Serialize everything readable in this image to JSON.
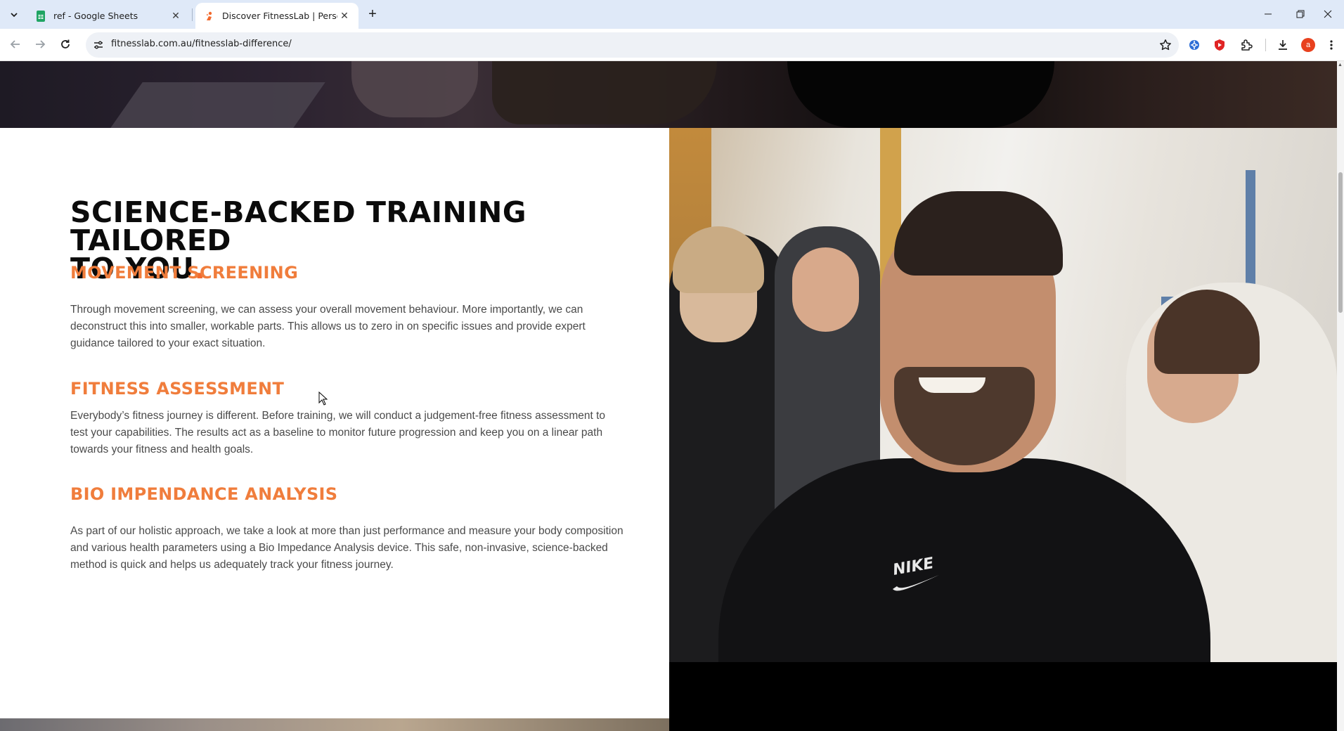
{
  "browser": {
    "tabs": [
      {
        "title": "ref - Google Sheets",
        "favicon": "google-sheets-icon",
        "active": false
      },
      {
        "title": "Discover FitnessLab | Personal T",
        "favicon": "fitnesslab-icon",
        "active": true
      }
    ],
    "url": "fitnesslab.com.au/fitnesslab-difference/",
    "profile_initial": "a",
    "accent_color": "#f26a2e"
  },
  "page": {
    "heading_line1": "SCIENCE-BACKED TRAINING TAILORED",
    "heading_line2": "TO YOU",
    "heading_dot": ".",
    "sections": [
      {
        "title": "MOVEMENT SCREENING",
        "body": "Through movement screening, we can assess your overall movement behaviour. More importantly, we can deconstruct this into smaller, workable parts. This allows us to zero in on specific issues and provide expert guidance tailored to your exact situation."
      },
      {
        "title": "FITNESS ASSESSMENT",
        "body": "Everybody’s fitness journey is different. Before training, we will conduct a judgement-free fitness assessment to test your capabilities. The results act as a baseline to monitor future progression and keep you on a linear path towards your fitness and health goals."
      },
      {
        "title": "BIO IMPENDANCE ANALYSIS",
        "body": "As part of our holistic approach, we take a look at more than just performance and measure your body composition and various health parameters using a Bio Impedance Analysis device. This safe, non-invasive, science-backed method is quick and helps us adequately track your fitness journey."
      }
    ],
    "photo_logo_text": "NIKE",
    "colors": {
      "heading": "#0b0b0b",
      "subheading": "#f07d3c",
      "body_text": "#4a4a4a"
    }
  }
}
